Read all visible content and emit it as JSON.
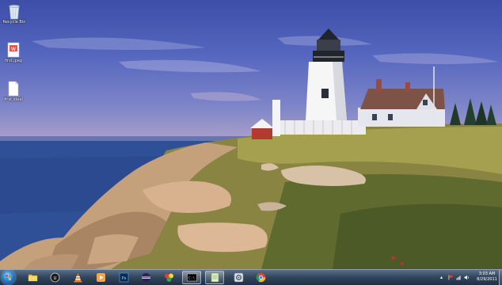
{
  "desktop": {
    "icons": [
      {
        "label": "Recycle Bin",
        "icon": "recycle-bin-icon"
      },
      {
        "label": "first.jpeg",
        "icon": "image-file-icon"
      },
      {
        "label": "first.ideal",
        "icon": "blank-file-icon"
      }
    ],
    "wallpaper": "lighthouse-on-rocky-coast"
  },
  "taskbar": {
    "start_icon": "windows-start-orb",
    "apps": [
      {
        "name": "windows-explorer",
        "icon": "folder-icon"
      },
      {
        "name": "udk",
        "icon": "udk-icon"
      },
      {
        "name": "vlc",
        "icon": "vlc-cone-icon"
      },
      {
        "name": "media-player",
        "icon": "media-player-icon"
      },
      {
        "name": "photoshop",
        "icon": "photoshop-icon"
      },
      {
        "name": "eclipse",
        "icon": "eclipse-icon"
      },
      {
        "name": "app-colored-circles",
        "icon": "circles-icon"
      },
      {
        "name": "command-prompt",
        "icon": "cmd-icon"
      },
      {
        "name": "notepad-plus",
        "icon": "notepad-icon"
      },
      {
        "name": "settings-app",
        "icon": "gear-app-icon"
      },
      {
        "name": "chrome",
        "icon": "chrome-icon"
      }
    ],
    "tray_icons": [
      "show-hidden-icons-icon",
      "action-center-flag-icon",
      "network-icon",
      "volume-icon"
    ],
    "clock": {
      "time": "3:03 AM",
      "date": "8/29/2011"
    },
    "colors": {
      "accent": "#2c7fd0",
      "taskbar": "#33475e"
    }
  }
}
